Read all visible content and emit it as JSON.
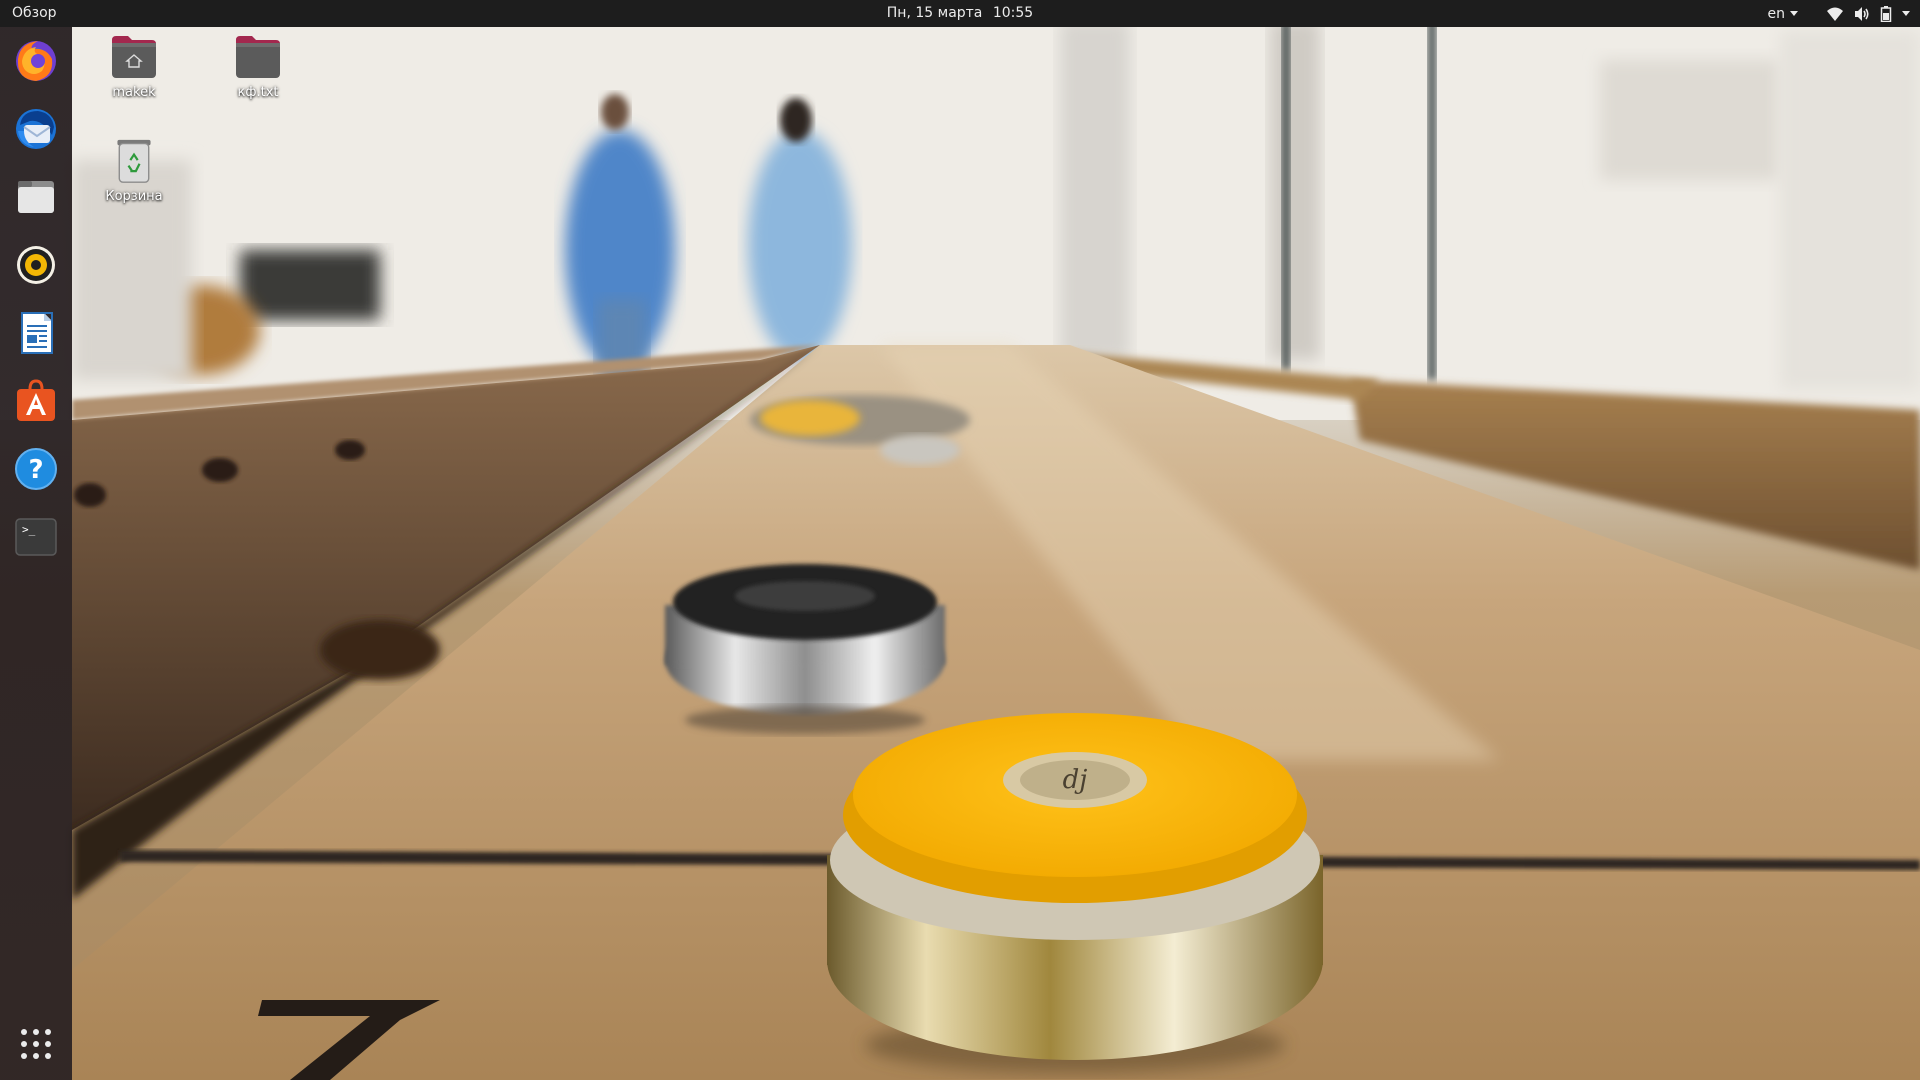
{
  "topbar": {
    "activities": "Обзор",
    "date": "Пн, 15 марта",
    "time": "10:55",
    "lang": "en"
  },
  "dock": {
    "items": [
      {
        "name": "firefox",
        "icon": "firefox-icon"
      },
      {
        "name": "thunderbird",
        "icon": "thunderbird-icon"
      },
      {
        "name": "files",
        "icon": "files-icon"
      },
      {
        "name": "rhythmbox",
        "icon": "rhythmbox-icon"
      },
      {
        "name": "libreoffice-writer",
        "icon": "writer-icon"
      },
      {
        "name": "ubuntu-software",
        "icon": "software-center-icon"
      },
      {
        "name": "help",
        "icon": "help-icon"
      },
      {
        "name": "terminal",
        "icon": "terminal-icon"
      }
    ],
    "show_apps": "grid-icon"
  },
  "desktop": {
    "icons": [
      {
        "label": "makek",
        "type": "home-folder"
      },
      {
        "label": "кф.txt",
        "type": "folder"
      },
      {
        "label": "Корзина",
        "type": "trash"
      }
    ]
  },
  "colors": {
    "topbar": "#1d1d1d",
    "dock": "#241b1d",
    "puck_yellow": "#f4b400",
    "table_wood": "#b8956a"
  }
}
